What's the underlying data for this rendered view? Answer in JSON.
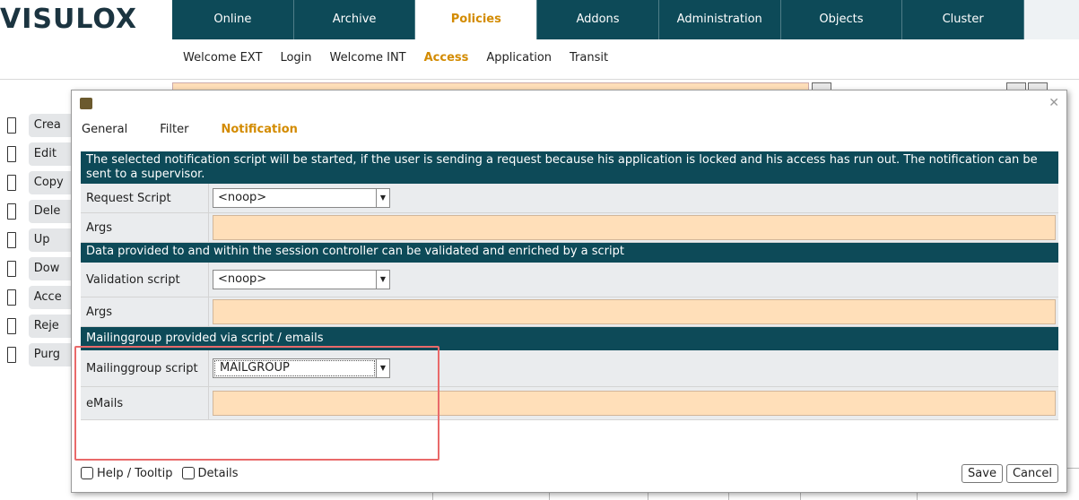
{
  "logo": {
    "text": "VISULOX"
  },
  "topnav": {
    "tabs": [
      "Online",
      "Archive",
      "Policies",
      "Addons",
      "Administration",
      "Objects",
      "Cluster"
    ],
    "active": "Policies"
  },
  "subnav": {
    "items": [
      "Welcome EXT",
      "Login",
      "Welcome INT",
      "Access",
      "Application",
      "Transit"
    ],
    "active": "Access"
  },
  "sidebar": {
    "items": [
      "Crea",
      "Edit",
      "Copy",
      "Dele",
      "Up",
      "Dow",
      "Acce",
      "Reje",
      "Purg"
    ]
  },
  "dialog": {
    "tabs": [
      "General",
      "Filter",
      "Notification"
    ],
    "active_tab": "Notification",
    "sections": [
      {
        "banner": "The selected notification script will be started, if the user is sending a request because his application is locked and his access has run out. The notification can be sent to a supervisor.",
        "request_label": "Request Script",
        "request_value": "<noop>",
        "args_label": "Args",
        "args_value": ""
      },
      {
        "banner": "Data provided to and within the session controller can be validated and enriched by a script",
        "validation_label": "Validation script",
        "validation_value": "<noop>",
        "args_label": "Args",
        "args_value": ""
      },
      {
        "banner": "Mailinggroup provided via script / emails",
        "mailing_label": "Mailinggroup script",
        "mailing_value": "MAILGROUP",
        "emails_label": "eMails",
        "emails_value": ""
      }
    ],
    "help_label": "Help / Tooltip",
    "details_label": "Details",
    "save_label": "Save",
    "cancel_label": "Cancel"
  },
  "colors": {
    "nav_bg": "#0d4a58",
    "accent": "#d38b00",
    "input_bg": "#ffdfb9",
    "highlight": "#e96a6a"
  }
}
